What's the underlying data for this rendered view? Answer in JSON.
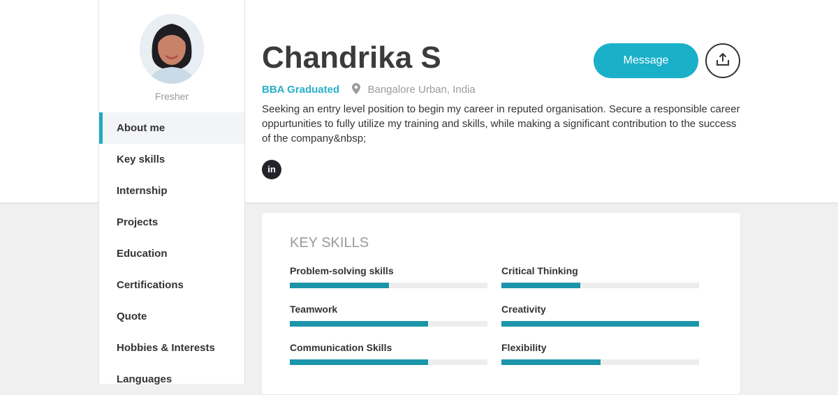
{
  "profile": {
    "name": "Chandrika S",
    "role": "Fresher",
    "qualification": "BBA Graduated",
    "location": "Bangalore Urban, India",
    "about": "Seeking an entry level position to begin my career in reputed organisation. Secure a responsible career oppurtunities to fully utilize my training and skills, while making a significant contribution to the success of the company&nbsp;",
    "social": {
      "linkedin_label": "in"
    }
  },
  "actions": {
    "message_label": "Message",
    "share_icon": "share-upload-icon"
  },
  "sidebar": {
    "items": [
      {
        "label": "About me",
        "active": true
      },
      {
        "label": "Key skills",
        "active": false
      },
      {
        "label": "Internship",
        "active": false
      },
      {
        "label": "Projects",
        "active": false
      },
      {
        "label": "Education",
        "active": false
      },
      {
        "label": "Certifications",
        "active": false
      },
      {
        "label": "Quote",
        "active": false
      },
      {
        "label": "Hobbies & Interests",
        "active": false
      },
      {
        "label": "Languages",
        "active": false
      }
    ]
  },
  "key_skills": {
    "title": "KEY SKILLS",
    "items": [
      {
        "name": "Problem-solving skills",
        "level": 0.5
      },
      {
        "name": "Critical Thinking",
        "level": 0.4
      },
      {
        "name": "Teamwork",
        "level": 0.7
      },
      {
        "name": "Creativity",
        "level": 1.0
      },
      {
        "name": "Communication Skills",
        "level": 0.7
      },
      {
        "name": "Flexibility",
        "level": 0.5
      }
    ]
  },
  "colors": {
    "accent": "#1ab0c9",
    "bar": "#1a95a9",
    "dark": "#23232b"
  }
}
